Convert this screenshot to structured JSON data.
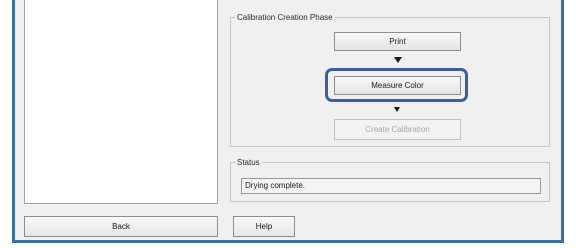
{
  "calibration": {
    "group_title": "Calibration Creation Phase",
    "print_label": "Print",
    "measure_color_label": "Measure Color",
    "create_calibration_label": "Create Calibration",
    "create_calibration_enabled": false,
    "highlighted_step": "Measure Color"
  },
  "status": {
    "group_title": "Status",
    "message": "Drying complete."
  },
  "footer": {
    "back_label": "Back",
    "help_label": "Help"
  },
  "colors": {
    "window_frame": "#3a6ea5",
    "highlight_ring": "#3d5f9e",
    "dialog_background": "#f0f0f0"
  }
}
